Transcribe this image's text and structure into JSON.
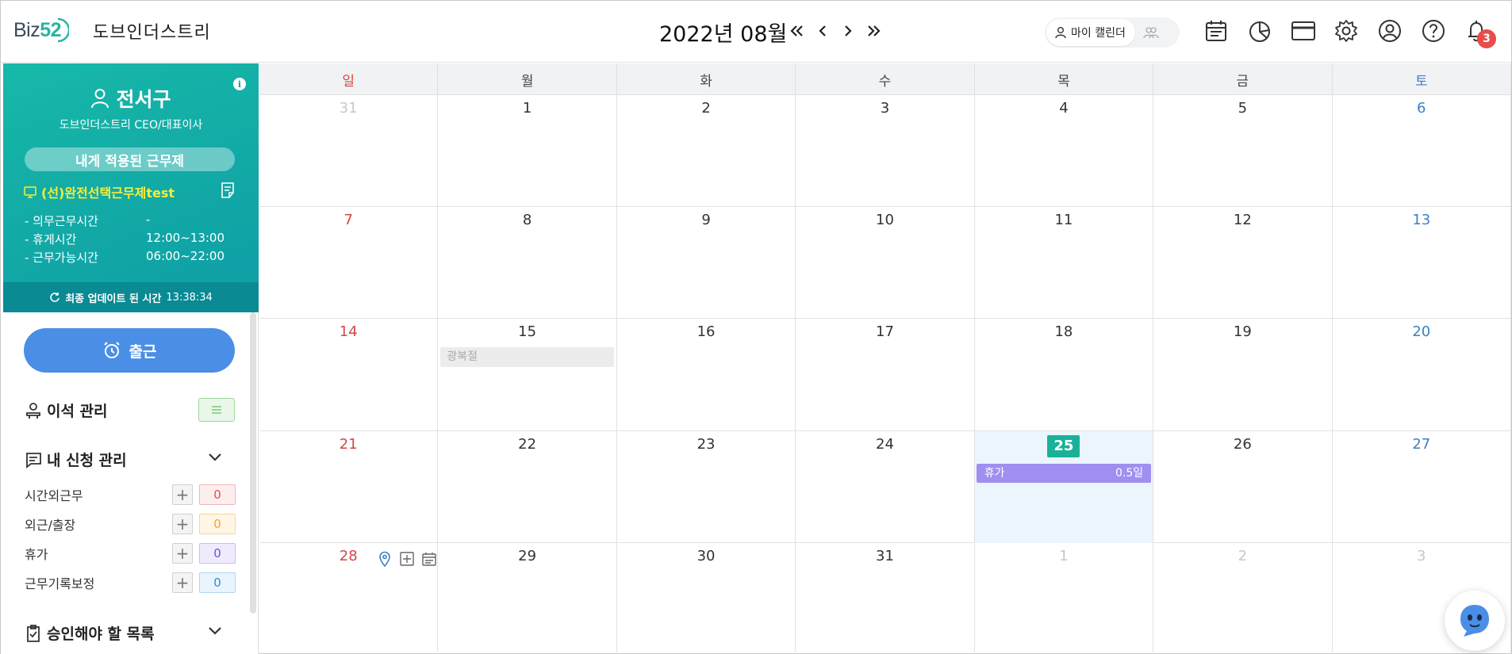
{
  "header": {
    "logo_text": "Biz",
    "logo_num": "52",
    "company": "도브인더스트리",
    "month": "2022년 08월",
    "my_calendar_label": "마이 캘린더",
    "notification_count": "3"
  },
  "profile": {
    "name": "전서구",
    "title": "도브인더스트리 CEO/대표이사",
    "work_system_label": "내게 적용된 근무제",
    "work_system_name": "(선)완전선택근무제test",
    "rows": [
      {
        "label": "- 의무근무시간",
        "value": "-"
      },
      {
        "label": "- 휴게시간",
        "value": "12:00~13:00"
      },
      {
        "label": "- 근무가능시간",
        "value": "06:00~22:00"
      }
    ],
    "update_label": "최종 업데이트 된 시간",
    "update_time": "13:38:34"
  },
  "sidebar": {
    "checkin_label": "출근",
    "seat_label": "이석 관리",
    "requests_label": "내 신청 관리",
    "requests": [
      {
        "label": "시간외근무",
        "count": "0",
        "color": "#e84c4c",
        "bg": "#fdeeee",
        "border": "#f2b8b8"
      },
      {
        "label": "외근/출장",
        "count": "0",
        "color": "#f0a531",
        "bg": "#fff6e5",
        "border": "#f6d7a0"
      },
      {
        "label": "휴가",
        "count": "0",
        "color": "#6a52d8",
        "bg": "#efebfd",
        "border": "#c8bdf4"
      },
      {
        "label": "근무기록보정",
        "count": "0",
        "color": "#2d8fd6",
        "bg": "#e9f4fc",
        "border": "#b1d6f0"
      }
    ],
    "approve_label": "승인해야 할 목록"
  },
  "calendar": {
    "weekdays": [
      "일",
      "월",
      "화",
      "수",
      "목",
      "금",
      "토"
    ],
    "weeks": [
      [
        "31",
        "1",
        "2",
        "3",
        "4",
        "5",
        "6"
      ],
      [
        "7",
        "8",
        "9",
        "10",
        "11",
        "12",
        "13"
      ],
      [
        "14",
        "15",
        "16",
        "17",
        "18",
        "19",
        "20"
      ],
      [
        "21",
        "22",
        "23",
        "24",
        "25",
        "26",
        "27"
      ],
      [
        "28",
        "29",
        "30",
        "31",
        "1",
        "2",
        "3"
      ]
    ],
    "holiday": "광복절",
    "vacation_label": "휴가",
    "vacation_amount": "0.5일"
  }
}
